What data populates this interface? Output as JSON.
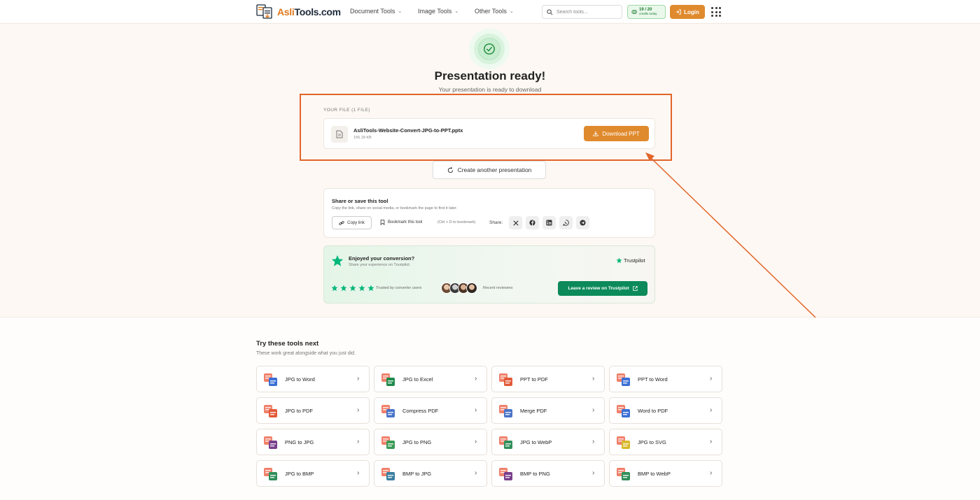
{
  "header": {
    "logo_part1": "Asli",
    "logo_part2": "Tools.com",
    "nav": [
      "Document Tools",
      "Image Tools",
      "Other Tools"
    ],
    "search_placeholder": "Search tools...",
    "credits_count": "19 / 20",
    "credits_label": "credits today",
    "login_label": "Login"
  },
  "result": {
    "title": "Presentation ready!",
    "subtitle": "Your presentation is ready to download",
    "file_label": "YOUR FILE (1 FILE)",
    "file_name": "AsliTools-Website-Convert-JPG-to-PPT.pptx",
    "file_size": "155.18 KB",
    "download_label": "Download PPT",
    "another_label": "Create another presentation"
  },
  "share": {
    "heading": "Share or save this tool",
    "description": "Copy the link, share on social media, or bookmark the page to find it later.",
    "copy_label": "Copy link",
    "bookmark_label": "Bookmark this tool",
    "shortcut_hint": "(Ctrl + D to bookmark)",
    "share_label": "Share:",
    "icons": [
      "x-icon",
      "facebook-icon",
      "linkedin-icon",
      "whatsapp-icon",
      "telegram-icon"
    ]
  },
  "trustpilot": {
    "heading": "Enjoyed your conversion?",
    "description": "Share your experience on Trustpilot.",
    "brand": "Trustpilot",
    "trusted_label": "Trusted by converter users",
    "recent_label": "Recent reviewers",
    "review_label": "Leave a review on Trustpilot",
    "rating": 5,
    "accent": "#00b67a"
  },
  "tools_section": {
    "heading": "Try these tools next",
    "description": "These work great alongside what you just did.",
    "tools": [
      {
        "label": "JPG to Word",
        "color": "#3b6fd6"
      },
      {
        "label": "JPG to Excel",
        "color": "#1f8a4c"
      },
      {
        "label": "PPT to PDF",
        "color": "#e25a3a"
      },
      {
        "label": "PPT to Word",
        "color": "#3b6fd6"
      },
      {
        "label": "JPG to PDF",
        "color": "#e25a3a"
      },
      {
        "label": "Compress PDF",
        "color": "#4a74c9"
      },
      {
        "label": "Merge PDF",
        "color": "#4a74c9"
      },
      {
        "label": "Word to PDF",
        "color": "#3b6fd6"
      },
      {
        "label": "PNG to JPG",
        "color": "#7a3f8c"
      },
      {
        "label": "JPG to PNG",
        "color": "#3a9a55"
      },
      {
        "label": "JPG to WebP",
        "color": "#2f8f5a"
      },
      {
        "label": "JPG to SVG",
        "color": "#d9b92a"
      },
      {
        "label": "JPG to BMP",
        "color": "#2f8f5a"
      },
      {
        "label": "BMP to JPG",
        "color": "#3a7fa0"
      },
      {
        "label": "BMP to PNG",
        "color": "#7a3f8c"
      },
      {
        "label": "BMP to WebP",
        "color": "#2f8f5a"
      }
    ]
  }
}
